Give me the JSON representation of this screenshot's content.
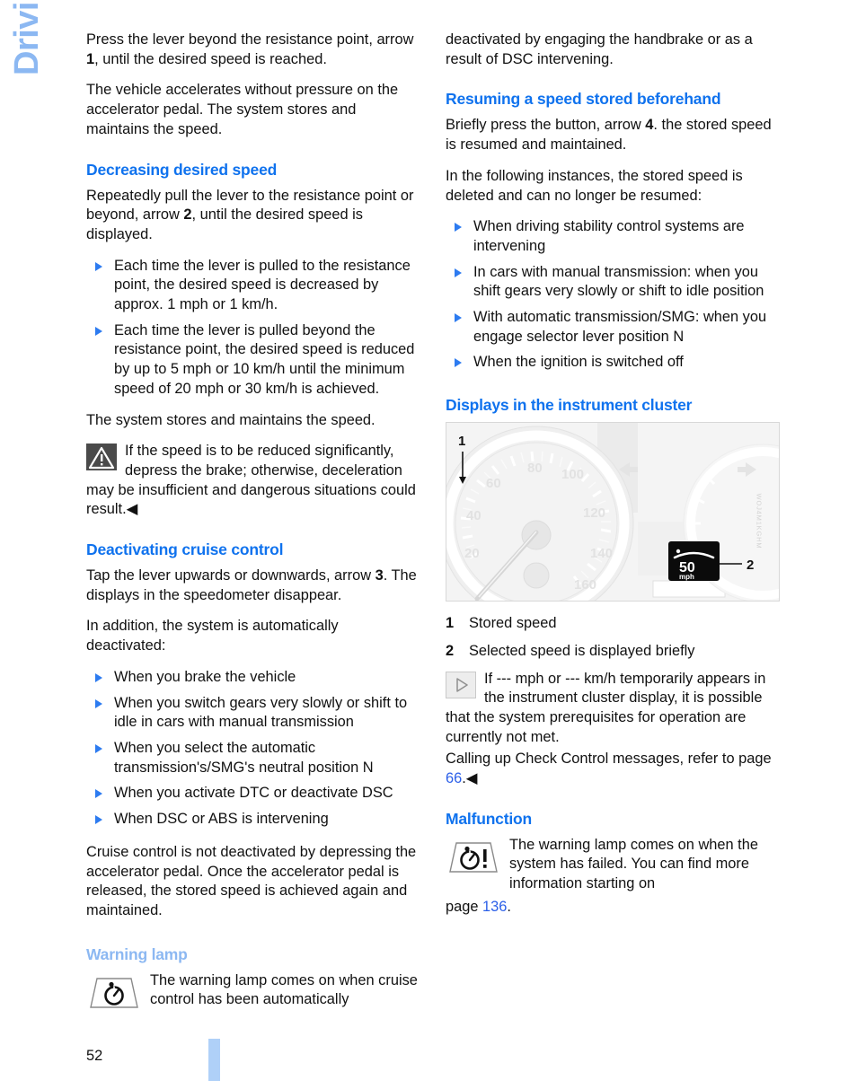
{
  "document": {
    "side_tab": "Driving",
    "page_number": "52"
  },
  "left_column": {
    "para_1_a": "Press the lever beyond the resistance point, arrow ",
    "para_1_num": "1",
    "para_1_b": ", until the desired speed is reached.",
    "para_2": "The vehicle accelerates without pressure on the accelerator pedal. The system stores and maintains the speed.",
    "heading_decreasing": "Decreasing desired speed",
    "para_3_a": "Repeatedly pull the lever to the resistance point or beyond, arrow ",
    "para_3_num": "2",
    "para_3_b": ", until the desired speed is displayed.",
    "bullets_decreasing": [
      "Each time the lever is pulled to the resistance point, the desired speed is decreased by approx. 1 mph or 1 km/h.",
      "Each time the lever is pulled beyond the resistance point, the desired speed is reduced by up to 5 mph or 10 km/h until the minimum speed of 20 mph or 30 km/h is achieved."
    ],
    "para_4": "The system stores and maintains the speed.",
    "warning_note": "If the speed is to be reduced significantly, depress the brake; otherwise, deceleration may be insufficient and dangerous situations could result.",
    "heading_deactivating": "Deactivating cruise control",
    "para_5_a": "Tap the lever upwards or downwards, arrow ",
    "para_5_num": "3",
    "para_5_b": ". The displays in the speedometer disappear.",
    "para_6": "In addition, the system is automatically deactivated:",
    "bullets_deactivating": [
      "When you brake the vehicle",
      "When you switch gears very slowly or shift to idle in cars with manual transmission",
      "When you select the automatic transmission's/SMG's neutral position N",
      "When you activate DTC or deactivate DSC",
      "When DSC or ABS is intervening"
    ],
    "para_7": "Cruise control is not deactivated by depressing the accelerator pedal. Once the accelerator pedal is released, the stored speed is achieved again and maintained.",
    "heading_warning_lamp": "Warning lamp",
    "warning_lamp_text": "The warning lamp comes on when cruise control has been automatically"
  },
  "right_column": {
    "para_1_cont": "deactivated by engaging the handbrake or as a result of DSC intervening.",
    "heading_resuming": "Resuming a speed stored beforehand",
    "para_2_a": "Briefly press the button, arrow ",
    "para_2_num": "4",
    "para_2_b": ". the stored speed is resumed and maintained.",
    "para_3": "In the following instances, the stored speed is deleted and can no longer be resumed:",
    "bullets_deleted": [
      "When driving stability control systems are intervening",
      "In cars with manual transmission: when you shift gears very slowly or shift to idle position",
      "With automatic transmission/SMG: when you engage selector lever position N",
      "When the ignition is switched off"
    ],
    "heading_displays": "Displays in the instrument cluster",
    "figure": {
      "code": "WOJ4M1KGHM",
      "callout_1": "1",
      "callout_2": "2",
      "lcd_speed": "50",
      "lcd_unit": "mph",
      "dial_ticks": [
        "20",
        "40",
        "60",
        "80",
        "100",
        "120",
        "140",
        "160"
      ]
    },
    "legend": [
      {
        "num": "1",
        "text": "Stored speed"
      },
      {
        "num": "2",
        "text": "Selected speed is displayed briefly"
      }
    ],
    "note_text": "If --- mph or --- km/h temporarily appears in the instrument cluster display, it is possible that the system prerequisites for operation are currently not met.",
    "note_follow_a": "Calling up Check Control messages, refer to page ",
    "note_follow_link": "66",
    "note_follow_b": ".",
    "heading_malfunction": "Malfunction",
    "malfunction_text": "The warning lamp comes on when the system has failed. You can find more information starting on",
    "malfunction_page_a": "page ",
    "malfunction_page_link": "136",
    "malfunction_page_b": "."
  },
  "colors": {
    "heading_blue": "#0F72EE",
    "light_blue": "#8CB8F2",
    "link_blue": "#2B5FE8",
    "bullet_blue": "#2D7BF0",
    "page_bar": "#AFD0F8"
  }
}
